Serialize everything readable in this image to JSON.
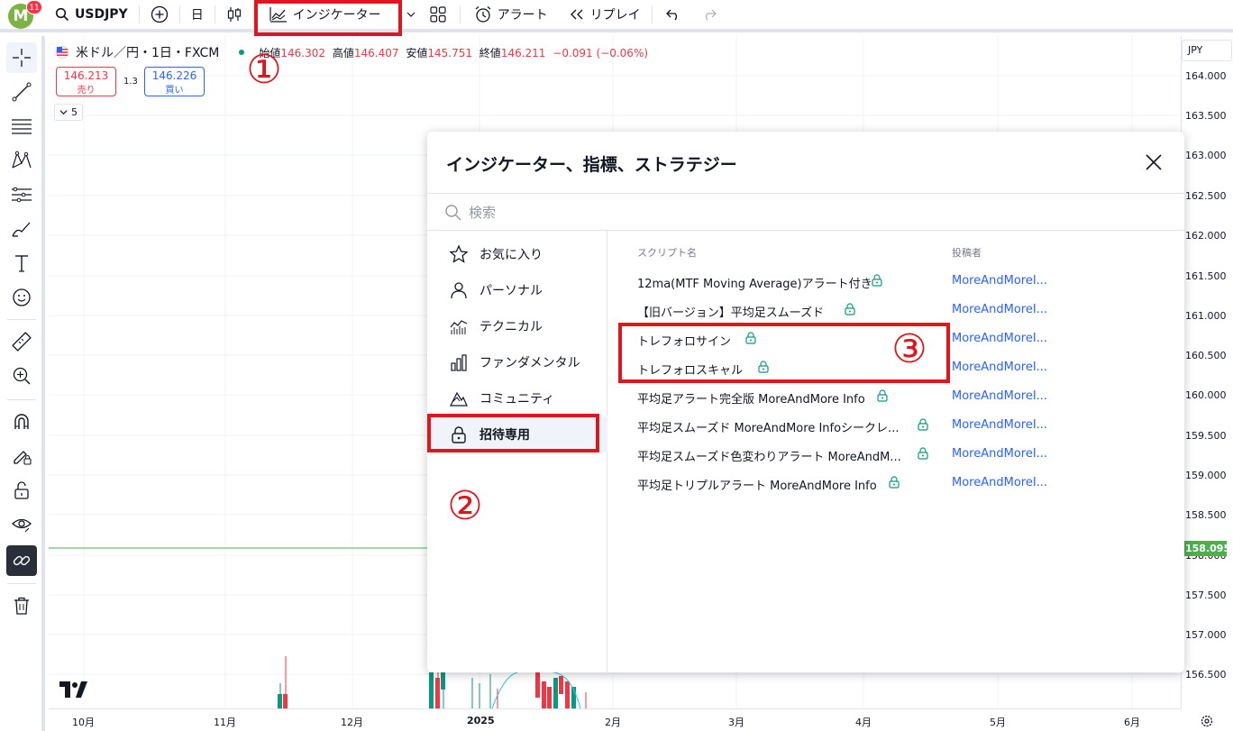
{
  "topbar": {
    "avatar_letter": "M",
    "avatar_badge": "11",
    "symbol": "USDJPY",
    "interval": "日",
    "indicators_label": "インジケーター",
    "alert_label": "アラート",
    "replay_label": "リプレイ"
  },
  "legend": {
    "title": "米ドル／円・1日・FXCM",
    "open_label": "始値",
    "open": "146.302",
    "high_label": "高値",
    "high": "146.407",
    "low_label": "安値",
    "low": "145.751",
    "close_label": "終値",
    "close": "146.211",
    "change": "−0.091 (−0.06%)",
    "sell_price": "146.213",
    "sell_label": "売り",
    "spread": "1.3",
    "buy_price": "146.226",
    "buy_label": "買い",
    "indicators_count": "5"
  },
  "price_axis": {
    "currency": "JPY",
    "labels": [
      "164.000",
      "163.500",
      "163.000",
      "162.500",
      "162.000",
      "161.500",
      "161.000",
      "160.500",
      "160.000",
      "159.500",
      "159.000",
      "158.500",
      "158.000",
      "157.500",
      "157.000",
      "156.500"
    ],
    "current_price": "158.095"
  },
  "time_axis": {
    "labels": [
      "10月",
      "11月",
      "12月",
      "2025",
      "2月",
      "3月",
      "4月",
      "5月",
      "6月"
    ]
  },
  "modal": {
    "title": "インジケーター、指標、ストラテジー",
    "search_placeholder": "検索",
    "categories": [
      {
        "label": "お気に入り",
        "icon": "star-icon"
      },
      {
        "label": "パーソナル",
        "icon": "user-icon"
      },
      {
        "label": "テクニカル",
        "icon": "chart-icon"
      },
      {
        "label": "ファンダメンタル",
        "icon": "bar-chart-icon"
      },
      {
        "label": "コミュニティ",
        "icon": "community-icon"
      },
      {
        "label": "招待専用",
        "icon": "lock-icon"
      }
    ],
    "active_category": "招待専用",
    "col_script": "スクリプト名",
    "col_author": "投稿者",
    "rows": [
      {
        "name": "12ma(MTF Moving Average)アラート付き",
        "author": "MoreAndMoreI..."
      },
      {
        "name": "【旧バージョン】平均足スムーズド",
        "author": "MoreAndMoreI..."
      },
      {
        "name": "トレフォロサイン",
        "author": "MoreAndMoreI..."
      },
      {
        "name": "トレフォロスキャル",
        "author": "MoreAndMoreI..."
      },
      {
        "name": "平均足アラート完全版 MoreAndMore Info",
        "author": "MoreAndMoreI..."
      },
      {
        "name": "平均足スムーズド MoreAndMore Infoシークレ...",
        "author": "MoreAndMoreI..."
      },
      {
        "name": "平均足スムーズド色変わりアラート MoreAndM...",
        "author": "MoreAndMoreI..."
      },
      {
        "name": "平均足トリプルアラート MoreAndMore Info",
        "author": "MoreAndMoreI..."
      }
    ]
  },
  "annotations": {
    "n1": "①",
    "n2": "②",
    "n3": "③"
  },
  "colors": {
    "accent": "#2962ff",
    "down": "#f23645",
    "up": "#089981",
    "annotation": "#e0161e",
    "price_line": "#4caf50"
  }
}
